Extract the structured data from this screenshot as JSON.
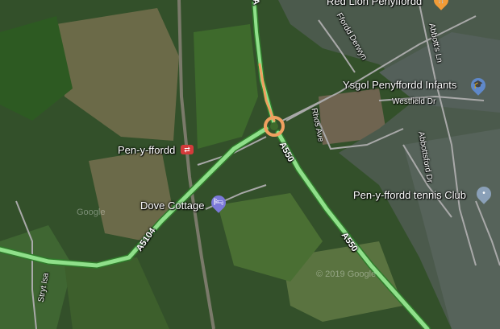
{
  "map": {
    "type": "satellite",
    "colors": {
      "major_road": "#8fe08a",
      "road_outline": "#2f7a2a",
      "highlight_road": "#f0a060",
      "minor_road": "#a9a9a9",
      "school_pin": "#5f88c9",
      "hotel_pin": "#7b79d9",
      "restaurant_pin": "#f29b37",
      "tennis_pin": "#8aa0b8",
      "rail_station": "#d43b3b"
    },
    "places": {
      "red_lion": "Red Lion Penyffordd",
      "ysgol": "Ysgol Penyffordd Infants",
      "pen_y_ffordd": "Pen-y-ffordd",
      "dove_cottage": "Dove Cottage",
      "tennis_club": "Pen-y-ffordd tennis Club"
    },
    "streets": {
      "ffordd_derwyn": "Ffordd Derwyn",
      "abbotts_ln": "Abbott's Ln",
      "westfield_dr": "Westfield Dr",
      "rhos_ave": "Rhos Ave",
      "abbottsford_dr": "Abbottsford Dr",
      "stryt_isa": "Stryt Isa"
    },
    "routes": {
      "a550_top": "A",
      "a550_mid": "A550",
      "a550_low": "A550",
      "a5104": "A5104"
    },
    "icons": {
      "restaurant": "restaurant-icon",
      "school": "school-icon",
      "hotel": "hotel-icon",
      "rail": "rail-station-icon",
      "tennis": "tennis-icon"
    },
    "watermarks": {
      "wm1": "© 2019 Google",
      "wm2": "Google"
    }
  }
}
